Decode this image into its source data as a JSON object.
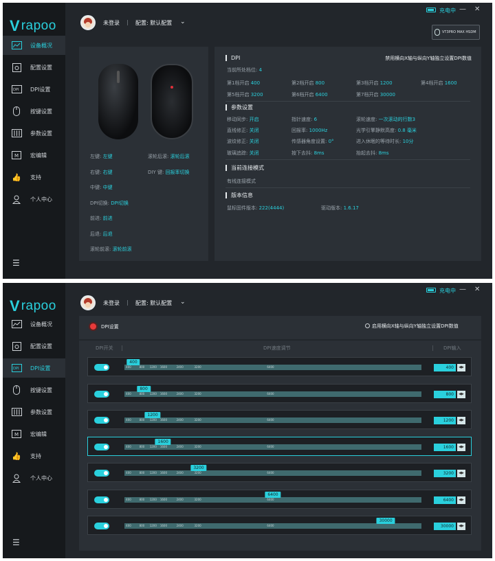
{
  "brand": {
    "logo_v": "V",
    "logo_text": "rapoo"
  },
  "nav_items": [
    {
      "label": "设备概况",
      "icon": "chart-icon"
    },
    {
      "label": "配置设置",
      "icon": "config-icon"
    },
    {
      "label": "DPI设置",
      "icon": "dpi-icon"
    },
    {
      "label": "按键设置",
      "icon": "mouse-icon"
    },
    {
      "label": "参数设置",
      "icon": "sliders-icon"
    },
    {
      "label": "宏编辑",
      "icon": "macro-icon"
    },
    {
      "label": "支持",
      "icon": "thumbs-up-icon"
    },
    {
      "label": "个人中心",
      "icon": "user-icon"
    }
  ],
  "header": {
    "login": "未登录",
    "separator": "|",
    "config": "配置: 默认配置",
    "charging": "充电中",
    "device": "VT3PRO MAX HSDM"
  },
  "overview": {
    "mouse_keys": [
      {
        "k": "左键:",
        "v": "左键"
      },
      {
        "k": "滚轮后滚:",
        "v": "滚轮后滚"
      },
      {
        "k": "右键:",
        "v": "右键"
      },
      {
        "k": "DIY 键:",
        "v": "回报率切换"
      },
      {
        "k": "中键:",
        "v": "中键"
      },
      {
        "k": "DPI切换:",
        "v": "DPI切换"
      },
      {
        "k": "前进:",
        "v": "前进"
      },
      {
        "k": "后退:",
        "v": "后退"
      },
      {
        "k": "滚轮前滚:",
        "v": "滚轮前滚"
      }
    ],
    "dpi_title": "DPI",
    "dpi_note": "禁用横向X轴与纵向Y轴独立设置DPI数值",
    "current_level_label": "当前所处档位:",
    "current_level": "4",
    "levels": [
      {
        "k": "第1档开启",
        "v": "400"
      },
      {
        "k": "第2档开启",
        "v": "800"
      },
      {
        "k": "第3档开启",
        "v": "1200"
      },
      {
        "k": "第4档开启",
        "v": "1600"
      },
      {
        "k": "第5档开启",
        "v": "3200"
      },
      {
        "k": "第6档开启",
        "v": "6400"
      },
      {
        "k": "第7档开启",
        "v": "30000"
      }
    ],
    "params_title": "参数设置",
    "params": [
      {
        "k": "移动同步:",
        "v": "开启"
      },
      {
        "k": "指针速度:",
        "v": "6"
      },
      {
        "k": "滚轮速度:",
        "v": "一次滚动的行数3"
      },
      {
        "k": "直线修正:",
        "v": "关闭"
      },
      {
        "k": "回报率:",
        "v": "1000Hz"
      },
      {
        "k": "光学引擎静默高度:",
        "v": "0.8 毫米"
      },
      {
        "k": "波纹修正:",
        "v": "关闭"
      },
      {
        "k": "传感器角度设置:",
        "v": "0°"
      },
      {
        "k": "进入休眠的等待时长:",
        "v": "10分"
      },
      {
        "k": "玻璃追踪:",
        "v": "关闭"
      },
      {
        "k": "按下去抖:",
        "v": "8ms"
      },
      {
        "k": "抬起去抖:",
        "v": "8ms"
      }
    ],
    "conn_title": "当前连接模式",
    "conn_value": "有线连接模式",
    "version_title": "版本信息",
    "fw_label": "鼠标固件版本:",
    "fw": "222(4444)",
    "drv_label": "驱动版本:",
    "drv": "1.6.17"
  },
  "dpi_page": {
    "title": "DPI设置",
    "independent_option": "启用横向X轴与纵向Y轴独立设置DPI数值",
    "col_switch": "DPI开关",
    "col_speed": "DPI速度调节",
    "col_input": "DPI输入",
    "tick_labels": [
      "400",
      "800",
      "1200",
      "1600",
      "2400",
      "3200",
      "6400"
    ],
    "rows": [
      {
        "value": "400",
        "enabled": true,
        "selected": false
      },
      {
        "value": "800",
        "enabled": true,
        "selected": false
      },
      {
        "value": "1200",
        "enabled": true,
        "selected": false
      },
      {
        "value": "1600",
        "enabled": true,
        "selected": true
      },
      {
        "value": "3200",
        "enabled": true,
        "selected": false
      },
      {
        "value": "6400",
        "enabled": true,
        "selected": false
      },
      {
        "value": "30000",
        "enabled": true,
        "selected": false
      }
    ],
    "arrows": "◀▶"
  },
  "colors": {
    "accent": "#2ad0dd",
    "panel": "#2b3036",
    "sidebar": "#16191c",
    "bg": "#22262b"
  }
}
